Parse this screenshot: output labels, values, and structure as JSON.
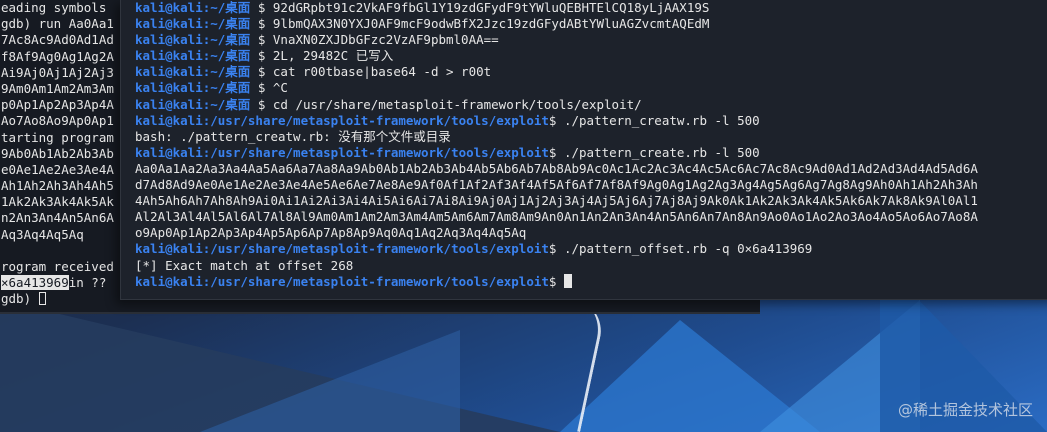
{
  "colors": {
    "prompt_blue": "#3a82f0",
    "terminal_bg": "#1d222b",
    "text": "#e6e6e6"
  },
  "back_terminal": {
    "lines": [
      "eading symbols",
      "gdb) run Aa0Aa1",
      "7Ac8Ac9Ad0Ad1Ad",
      "f8Af9Ag0Ag1Ag2A",
      "Ai9Aj0Aj1Aj2Aj3",
      "9Am0Am1Am2Am3Am",
      "p0Ap1Ap2Ap3Ap4A",
      "Ao7Ao8Ao9Ap0Ap1",
      "tarting program",
      "9Ab0Ab1Ab2Ab3Ab",
      "e0Ae1Ae2Ae3Ae4A",
      "Ah1Ah2Ah3Ah4Ah5",
      "1Ak2Ak3Ak4Ak5Ak",
      "n2An3An4An5An6A",
      "Aq3Aq4Aq5Aq",
      "",
      "rogram received",
      "in ??",
      "gdb) "
    ],
    "highlight_addr": "×6a413969"
  },
  "front_terminal": {
    "user_host": "kali@kali",
    "home_dir": ":~/桌面",
    "exploit_dir": ":/usr/share/metasploit-framework/tools/exploit",
    "prompt_sym": "$",
    "entries": [
      {
        "cmd": "92dGRpbt91c2VkAF9fbGl1Y19zdGFydF9tYWluQEBHTElCQ18yLjAAX19S"
      },
      {
        "cmd": "9lbmQAX3N0YXJ0AF9mcF9odwBfX2Jzc19zdGFydABtYWluAGZvcmtAQEdM"
      },
      {
        "cmd": "VnaXN0ZXJDbGFzc2VzAF9pbml0AA=="
      },
      {
        "cmd": "2L, 29482C 已写入"
      },
      {
        "cmd": "cat r00tbase|base64 -d > r00t"
      },
      {
        "cmd": "^C"
      },
      {
        "cmd": "cd /usr/share/metasploit-framework/tools/exploit/"
      }
    ],
    "exploit_entries": [
      {
        "cmd": "./pattern_creatw.rb -l 500",
        "output": [
          "bash: ./pattern_creatw.rb: 没有那个文件或目录"
        ]
      },
      {
        "cmd": "./pattern_create.rb -l 500",
        "output": [
          "Aa0Aa1Aa2Aa3Aa4Aa5Aa6Aa7Aa8Aa9Ab0Ab1Ab2Ab3Ab4Ab5Ab6Ab7Ab8Ab9Ac0Ac1Ac2Ac3Ac4Ac5Ac6Ac7Ac8Ac9Ad0Ad1Ad2Ad3Ad4Ad5Ad6A",
          "d7Ad8Ad9Ae0Ae1Ae2Ae3Ae4Ae5Ae6Ae7Ae8Ae9Af0Af1Af2Af3Af4Af5Af6Af7Af8Af9Ag0Ag1Ag2Ag3Ag4Ag5Ag6Ag7Ag8Ag9Ah0Ah1Ah2Ah3Ah",
          "4Ah5Ah6Ah7Ah8Ah9Ai0Ai1Ai2Ai3Ai4Ai5Ai6Ai7Ai8Ai9Aj0Aj1Aj2Aj3Aj4Aj5Aj6Aj7Aj8Aj9Ak0Ak1Ak2Ak3Ak4Ak5Ak6Ak7Ak8Ak9Al0Al1",
          "Al2Al3Al4Al5Al6Al7Al8Al9Am0Am1Am2Am3Am4Am5Am6Am7Am8Am9An0An1An2An3An4An5An6An7An8An9Ao0Ao1Ao2Ao3Ao4Ao5Ao6Ao7Ao8A",
          "o9Ap0Ap1Ap2Ap3Ap4Ap5Ap6Ap7Ap8Ap9Aq0Aq1Aq2Aq3Aq4Aq5Aq"
        ]
      },
      {
        "cmd": "./pattern_offset.rb -q 0×6a413969",
        "output": [
          "[*] Exact match at offset 268"
        ]
      }
    ]
  },
  "watermark": "@稀土掘金技术社区"
}
